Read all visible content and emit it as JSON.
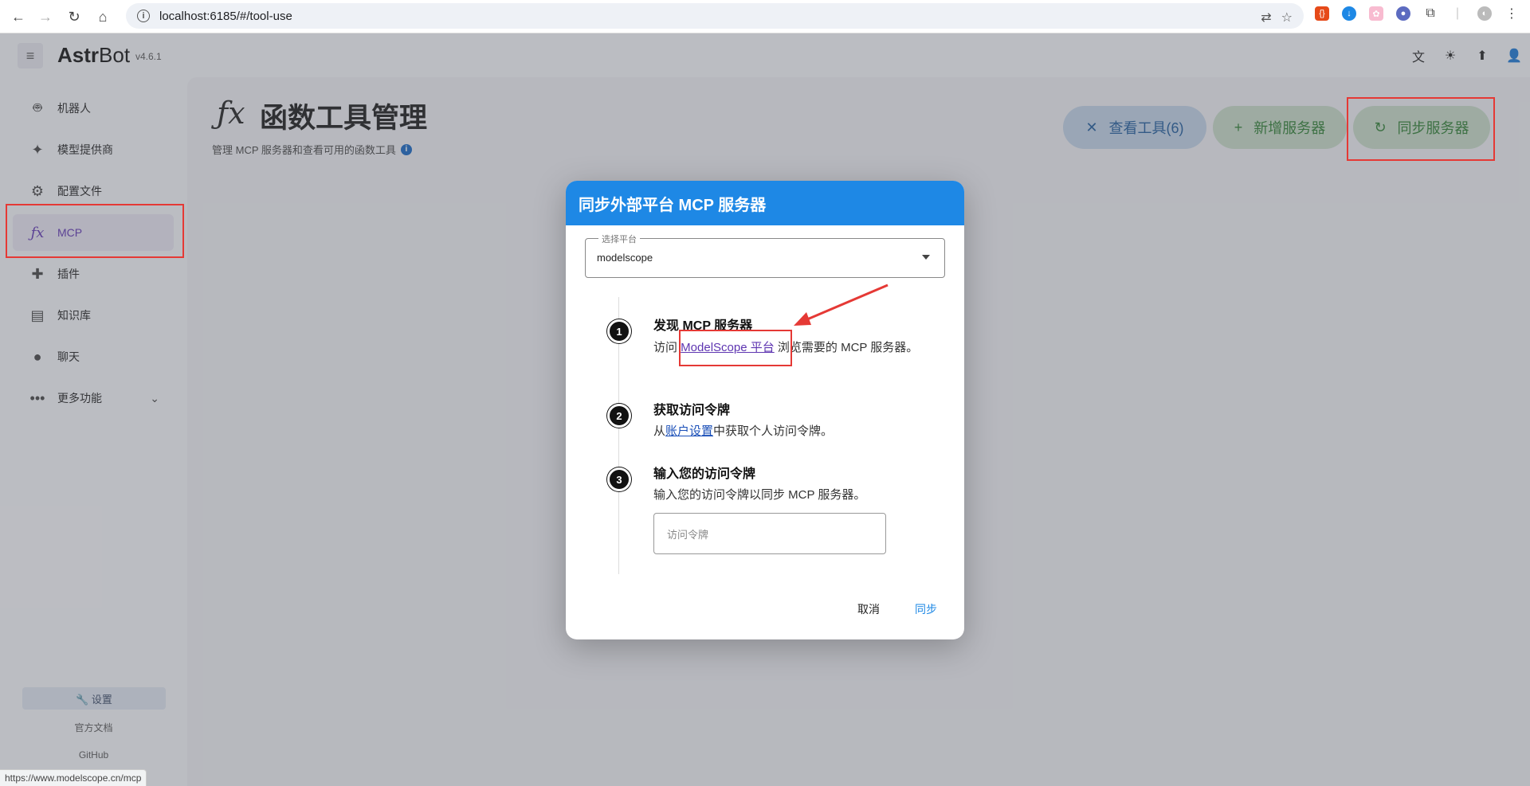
{
  "browser": {
    "url": "localhost:6185/#/tool-use",
    "status_url": "https://www.modelscope.cn/mcp"
  },
  "header": {
    "brand_bold": "Astr",
    "brand_rest": "Bot",
    "version": "v4.6.1"
  },
  "sidebar": {
    "items": [
      {
        "label": "机器人",
        "icon": "robot-icon"
      },
      {
        "label": "模型提供商",
        "icon": "sparkle-icon"
      },
      {
        "label": "配置文件",
        "icon": "gear-icon"
      },
      {
        "label": "MCP",
        "icon": "function-icon"
      },
      {
        "label": "插件",
        "icon": "puzzle-icon"
      },
      {
        "label": "知识库",
        "icon": "book-icon"
      },
      {
        "label": "聊天",
        "icon": "chat-icon"
      },
      {
        "label": "更多功能",
        "icon": "more-icon"
      }
    ],
    "settings_label": "🔧 设置",
    "docs_label": "官方文档",
    "github_label": "GitHub"
  },
  "main": {
    "title_icon": "ƒx",
    "title": "函数工具管理",
    "subtitle": "管理 MCP 服务器和查看可用的函数工具",
    "btn_tools": "查看工具(6)",
    "btn_add": "新增服务器",
    "btn_sync": "同步服务器"
  },
  "dialog": {
    "title": "同步外部平台 MCP 服务器",
    "select_label": "选择平台",
    "select_value": "modelscope",
    "steps": [
      {
        "num": "1",
        "title": "发现 MCP 服务器",
        "pre": "访问 ",
        "link": "ModelScope 平台",
        "post": " 浏览需要的 MCP 服务器。"
      },
      {
        "num": "2",
        "title": "获取访问令牌",
        "pre": "从",
        "link": "账户设置",
        "post": "中获取个人访问令牌。"
      },
      {
        "num": "3",
        "title": "输入您的访问令牌",
        "text": "输入您的访问令牌以同步 MCP 服务器。"
      }
    ],
    "token_placeholder": "访问令牌",
    "cancel": "取消",
    "sync": "同步"
  },
  "colors": {
    "primary": "#1e88e5",
    "accent_purple": "#5e35b1",
    "highlight_red": "#e53935"
  }
}
